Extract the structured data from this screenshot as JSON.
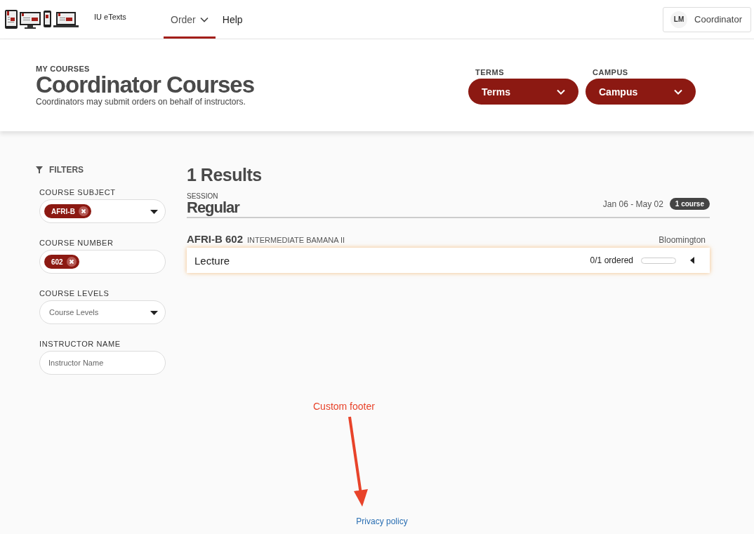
{
  "brand": {
    "name": "IU eTexts"
  },
  "nav": [
    {
      "label": "Order",
      "selected": true,
      "dropdown": true
    },
    {
      "label": "Help",
      "selected": false,
      "dropdown": false
    }
  ],
  "user": {
    "initials": "LM",
    "role": "Coordinator"
  },
  "hero": {
    "eyebrow": "MY COURSES",
    "title": "Coordinator Courses",
    "subtitle": "Coordinators may submit orders on behalf of instructors.",
    "selects": [
      {
        "label": "TERMS",
        "value": "Terms"
      },
      {
        "label": "CAMPUS",
        "value": "Campus"
      }
    ]
  },
  "filters": {
    "title": "FILTERS",
    "fields": [
      {
        "kind": "tags",
        "label": "COURSE SUBJECT",
        "tags": [
          "AFRI-B"
        ],
        "dropdown": true
      },
      {
        "kind": "tags",
        "label": "COURSE NUMBER",
        "tags": [
          "602"
        ],
        "dropdown": false
      },
      {
        "kind": "select",
        "label": "COURSE LEVELS",
        "placeholder": "Course Levels"
      },
      {
        "kind": "text",
        "label": "INSTRUCTOR NAME",
        "placeholder": "Instructor Name"
      }
    ]
  },
  "results": {
    "count": "1 Results",
    "sessions": [
      {
        "label": "SESSION",
        "name": "Regular",
        "dates": "Jan 06 - May 02",
        "badge": "1 course",
        "courses": [
          {
            "code": "AFRI-B 602",
            "title": "INTERMEDIATE BAMANA II",
            "campus": "Bloomington",
            "sections": [
              {
                "name": "Lecture",
                "ordered": "0/1 ordered",
                "level": 0,
                "expanded": false
              }
            ]
          }
        ]
      }
    ]
  },
  "annotation": {
    "text": "Custom footer"
  },
  "footer": {
    "link": "Privacy policy"
  }
}
